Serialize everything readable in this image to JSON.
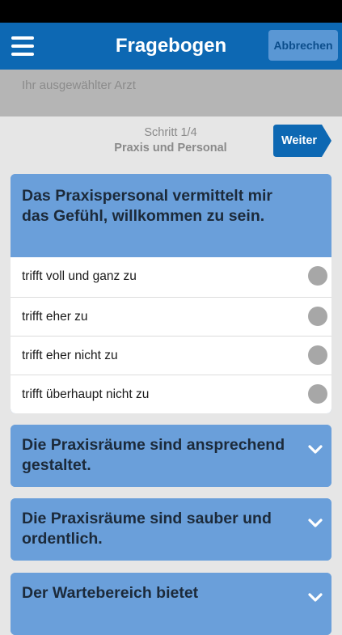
{
  "header": {
    "title": "Fragebogen",
    "menu_icon": "hamburger-menu-icon",
    "cancel_label": "Abbrechen"
  },
  "doctor": {
    "placeholder": "Ihr ausgewählter Arzt"
  },
  "step": {
    "counter": "Schritt 1/4",
    "section": "Praxis und Personal",
    "next_label": "Weiter"
  },
  "questions": [
    {
      "text": "Das Praxispersonal vermittelt mir das Gefühl, willkommen zu sein.",
      "expanded": true,
      "options": [
        "trifft voll und ganz zu",
        "trifft eher zu",
        "trifft eher nicht zu",
        "trifft überhaupt nicht zu"
      ]
    },
    {
      "text": "Die Praxisräume sind ansprechend gestaltet.",
      "expanded": false
    },
    {
      "text": "Die Praxisräume sind sauber und ordentlich.",
      "expanded": false
    },
    {
      "text": "Der Wartebereich bietet",
      "expanded": false
    }
  ],
  "colors": {
    "nav_blue": "#0d68b3",
    "card_blue": "#6a9fda",
    "cancel_bg": "#5a97d4",
    "next_bg": "#0d68b3",
    "radio_gray": "#a7a7a7"
  }
}
